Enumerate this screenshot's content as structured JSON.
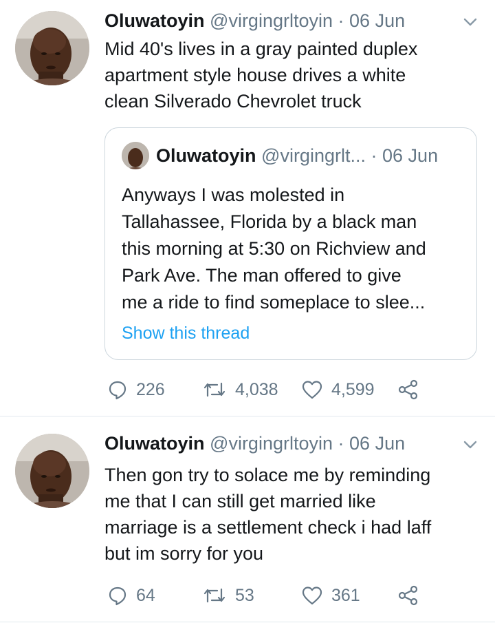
{
  "tweets": [
    {
      "name": "Oluwatoyin",
      "handle": "@virgingrltoyin",
      "separator": "·",
      "date": "06 Jun",
      "text": "Mid 40's lives in a gray painted duplex\napartment style house drives a white\nclean Silverado Chevrolet truck",
      "quoted": {
        "name": "Oluwatoyin",
        "handle": "@virgingrlt...",
        "separator": "·",
        "date": "06 Jun",
        "text": "Anyways I was molested in\nTallahassee, Florida by a black man\nthis morning at 5:30 on Richview and\nPark Ave. The man offered to give\nme a ride to find someplace to slee...",
        "show_thread": "Show this thread"
      },
      "replies": "226",
      "retweets": "4,038",
      "likes": "4,599"
    },
    {
      "name": "Oluwatoyin",
      "handle": "@virgingrltoyin",
      "separator": "·",
      "date": "06 Jun",
      "text": "Then gon try to solace me by reminding\nme that I can still get married like\nmarriage is a settlement check i had laff\nbut im sorry for you",
      "replies": "64",
      "retweets": "53",
      "likes": "361"
    }
  ],
  "icons": {
    "reply": "reply-icon",
    "retweet": "retweet-icon",
    "like": "heart-icon",
    "share": "share-icon",
    "caret": "chevron-down-icon"
  },
  "colors": {
    "text": "#14171a",
    "secondary": "#657786",
    "link": "#1da1f2",
    "border": "#ccd6dd"
  }
}
